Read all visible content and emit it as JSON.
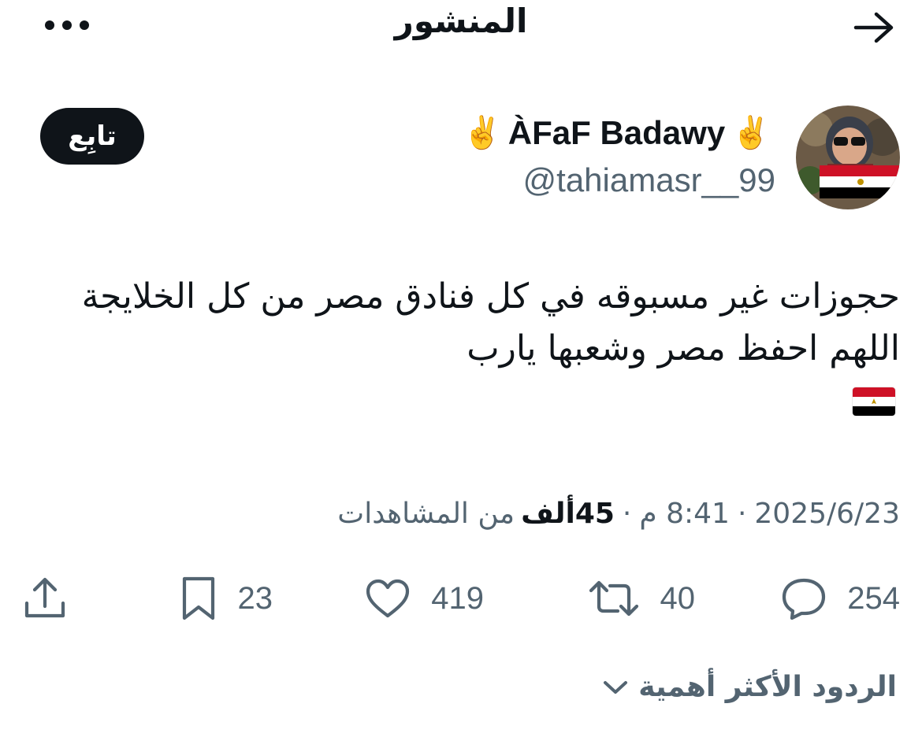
{
  "header": {
    "title": "المنشور",
    "back_icon": "arrow-right-icon",
    "more_icon": "more-horizontal-icon"
  },
  "author": {
    "display_name": "ÀFaF Badawy",
    "name_emoji": "✌️",
    "handle": "@tahiamasr__99",
    "follow_label": "تابِع"
  },
  "tweet": {
    "lines": [
      "حجوزات غير مسبوقه في كل فنادق مصر من كل الخلايجة",
      "اللهم احفظ مصر وشعبها يارب"
    ],
    "flag_icon": "egypt-flag-icon"
  },
  "meta": {
    "date": "2025/6/23",
    "time": "8:41 م",
    "views_count": "45ألف",
    "views_label": "من المشاهدات"
  },
  "actions": {
    "replies": "254",
    "reposts": "40",
    "likes": "419",
    "bookmarks": "23"
  },
  "replies_sort": {
    "label": "الردود الأكثر أهمية"
  },
  "colors": {
    "text": "#0f1419",
    "secondary": "#536471",
    "button_bg": "#0f1419"
  }
}
